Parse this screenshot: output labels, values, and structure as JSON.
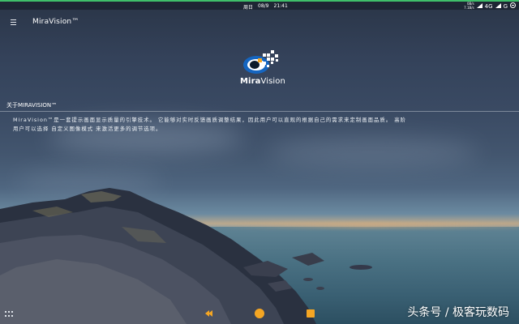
{
  "status_bar": {
    "day": "周日",
    "date": "08/9",
    "time": "21:41",
    "speed_top": "0B/s",
    "speed_bottom": "7.1B/s",
    "network": "4G",
    "network2": "G",
    "icons": [
      "signal-icon",
      "battery-icon"
    ]
  },
  "app_bar": {
    "menu_icon": "hamburger-menu-icon",
    "title": "MiraVision™"
  },
  "logo": {
    "word_bold": "Mira",
    "word_regular": "Vision"
  },
  "about": {
    "heading": "关于MIRAVISION™",
    "lines": [
      "MiraVision™是一套提示画面显示质量的引擎技术。 它能够对实时反馈画质调整结果，因此用户可以直观的根据自己的需求来定制画面品质。 高阶",
      "用户可以选择 自定义图像模式 来激活更多的调节选项。"
    ]
  },
  "nav_bar": {
    "back_icon": "back-icon",
    "home_icon": "home-icon",
    "recents_icon": "recents-icon",
    "apps_icon": "grid-icon",
    "accent": "#f5a623"
  },
  "watermark": "头条号 / 极客玩数码"
}
